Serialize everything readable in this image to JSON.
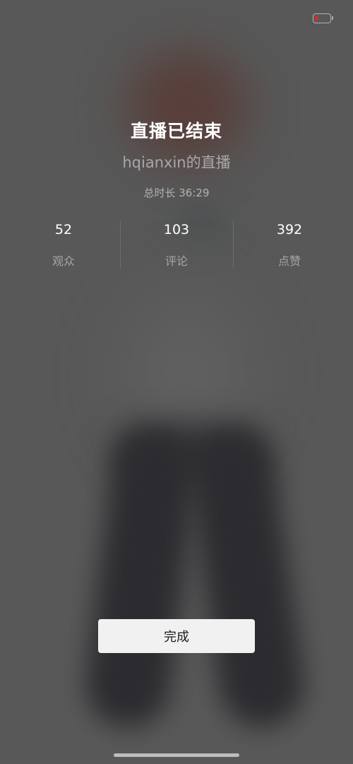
{
  "live_end": {
    "title": "直播已结束",
    "host_stream": "hqianxin的直播",
    "duration": "总时长 36:29"
  },
  "stats": [
    {
      "value": "52",
      "label": "观众"
    },
    {
      "value": "103",
      "label": "评论"
    },
    {
      "value": "392",
      "label": "点赞"
    }
  ],
  "actions": {
    "done_label": "完成"
  },
  "status_bar": {
    "battery_icon": "battery-low-icon",
    "battery_color": "#e02a2a"
  }
}
